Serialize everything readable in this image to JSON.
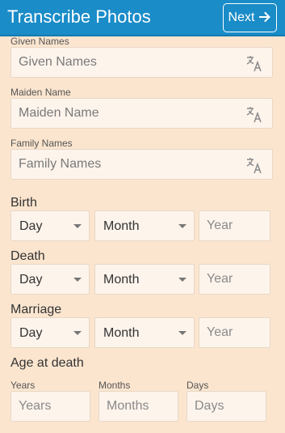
{
  "header": {
    "title": "Transcribe Photos",
    "next_label": "Next",
    "next_icon": "arrow-right-icon",
    "background_color": "#1A8CC8"
  },
  "names": {
    "given": {
      "label": "Given Names",
      "placeholder": "Given Names",
      "icon": "transliterate-icon"
    },
    "maiden": {
      "label": "Maiden Name",
      "placeholder": "Maiden Name",
      "icon": "transliterate-icon"
    },
    "family": {
      "label": "Family Names",
      "placeholder": "Family Names",
      "icon": "transliterate-icon"
    }
  },
  "birth": {
    "label": "Birth",
    "day": "Day",
    "month": "Month",
    "year_placeholder": "Year"
  },
  "death": {
    "label": "Death",
    "day": "Day",
    "month": "Month",
    "year_placeholder": "Year"
  },
  "marriage": {
    "label": "Marriage",
    "day": "Day",
    "month": "Month",
    "year_placeholder": "Year"
  },
  "age_at_death": {
    "label": "Age at death",
    "years": {
      "label": "Years",
      "placeholder": "Years"
    },
    "months": {
      "label": "Months",
      "placeholder": "Months"
    },
    "days": {
      "label": "Days",
      "placeholder": "Days"
    }
  },
  "colors": {
    "page_background": "#FBE5CF",
    "field_background": "#FDF4EC"
  }
}
